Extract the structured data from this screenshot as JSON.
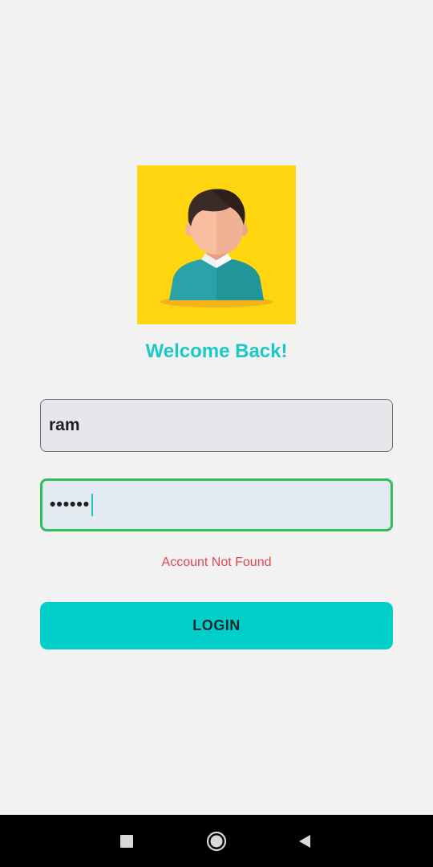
{
  "avatar": {
    "icon": "user-avatar-icon",
    "background": "#ffd60f"
  },
  "welcome_text": "Welcome Back!",
  "username": {
    "value": "ram"
  },
  "password": {
    "masked_value": "••••••"
  },
  "error_message": "Account Not Found",
  "login_label": "LOGIN",
  "colors": {
    "accent": "#00cec9",
    "error": "#e0474c",
    "focus_border": "#2fbf5a"
  },
  "navbar": {
    "recents_icon": "square-recents-icon",
    "home_icon": "circle-home-icon",
    "back_icon": "triangle-back-icon"
  }
}
